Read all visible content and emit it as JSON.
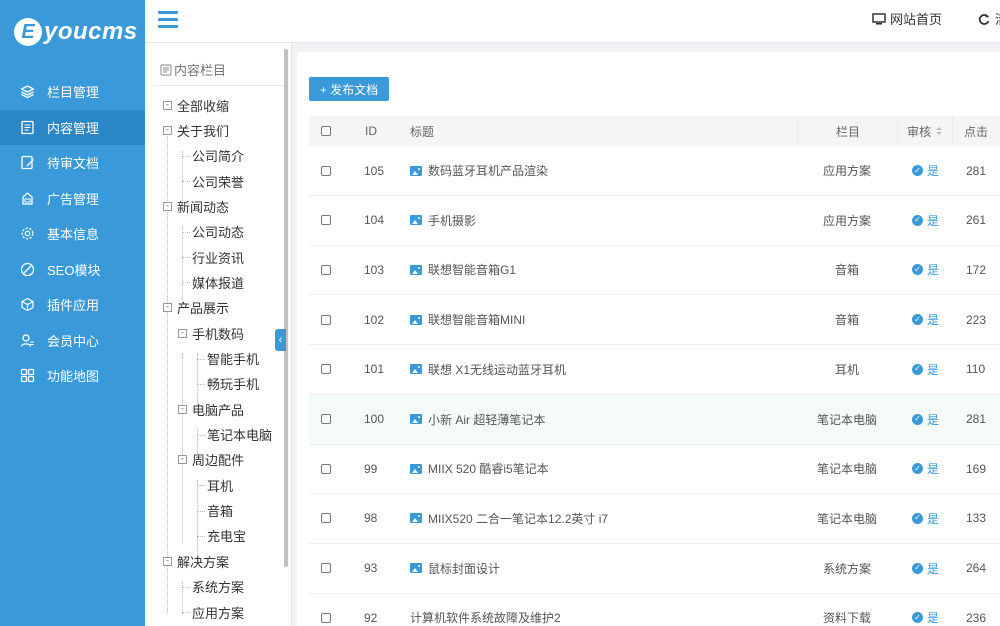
{
  "logo": {
    "letter": "E",
    "text": "youcms"
  },
  "header": {
    "home_label": "网站首页",
    "clear_label": "清"
  },
  "sidebar": {
    "items": [
      {
        "label": "栏目管理",
        "icon": "layers-icon"
      },
      {
        "label": "内容管理",
        "icon": "document-icon"
      },
      {
        "label": "待审文档",
        "icon": "edit-doc-icon"
      },
      {
        "label": "广告管理",
        "icon": "ad-icon"
      },
      {
        "label": "基本信息",
        "icon": "gear-icon"
      },
      {
        "label": "SEO模块",
        "icon": "seo-icon"
      },
      {
        "label": "插件应用",
        "icon": "plugin-icon"
      },
      {
        "label": "会员中心",
        "icon": "user-icon"
      },
      {
        "label": "功能地图",
        "icon": "grid-icon"
      }
    ],
    "active_index": 1
  },
  "tree": {
    "title": "内容栏目",
    "nodes": [
      {
        "label": "全部收缩",
        "box": "-"
      },
      {
        "label": "关于我们",
        "box": "-"
      },
      {
        "label": "公司简介"
      },
      {
        "label": "公司荣誉"
      },
      {
        "label": "新闻动态",
        "box": "-"
      },
      {
        "label": "公司动态"
      },
      {
        "label": "行业资讯"
      },
      {
        "label": "媒体报道"
      },
      {
        "label": "产品展示",
        "box": "-"
      },
      {
        "label": "手机数码",
        "box": "-"
      },
      {
        "label": "智能手机"
      },
      {
        "label": "畅玩手机"
      },
      {
        "label": "电脑产品",
        "box": "-"
      },
      {
        "label": "笔记本电脑"
      },
      {
        "label": "周边配件",
        "box": "-"
      },
      {
        "label": "耳机"
      },
      {
        "label": "音箱"
      },
      {
        "label": "充电宝"
      },
      {
        "label": "解决方案",
        "box": "-"
      },
      {
        "label": "系统方案"
      },
      {
        "label": "应用方案"
      }
    ]
  },
  "main": {
    "add_button": "+ 发布文档",
    "columns": {
      "id": "ID",
      "title": "标题",
      "category": "栏目",
      "audit": "审核",
      "clicks": "点击"
    },
    "rows": [
      {
        "id": "105",
        "title": "数码蓝牙耳机产品渲染",
        "has_image": true,
        "category": "应用方案",
        "audit": "是",
        "clicks": "281"
      },
      {
        "id": "104",
        "title": "手机摄影",
        "has_image": true,
        "category": "应用方案",
        "audit": "是",
        "clicks": "261"
      },
      {
        "id": "103",
        "title": "联想智能音箱G1",
        "has_image": true,
        "category": "音箱",
        "audit": "是",
        "clicks": "172"
      },
      {
        "id": "102",
        "title": "联想智能音箱MINI",
        "has_image": true,
        "category": "音箱",
        "audit": "是",
        "clicks": "223"
      },
      {
        "id": "101",
        "title": "联想 X1无线运动蓝牙耳机",
        "has_image": true,
        "category": "耳机",
        "audit": "是",
        "clicks": "110"
      },
      {
        "id": "100",
        "title": "小新 Air 超轻薄笔记本",
        "has_image": true,
        "category": "笔记本电脑",
        "audit": "是",
        "clicks": "281"
      },
      {
        "id": "99",
        "title": "MIIX 520 酷睿i5笔记本",
        "has_image": true,
        "category": "笔记本电脑",
        "audit": "是",
        "clicks": "169"
      },
      {
        "id": "98",
        "title": "MIIX520 二合一笔记本12.2英寸 i7",
        "has_image": true,
        "category": "笔记本电脑",
        "audit": "是",
        "clicks": "133"
      },
      {
        "id": "93",
        "title": "鼠标封面设计",
        "has_image": true,
        "category": "系统方案",
        "audit": "是",
        "clicks": "264"
      },
      {
        "id": "92",
        "title": "计算机软件系统故障及维护2",
        "has_image": false,
        "category": "资料下载",
        "audit": "是",
        "clicks": "236"
      }
    ],
    "highlighted_row": 5
  },
  "colors": {
    "accent": "#3a9ad9",
    "sidebar": "#3a9ad9",
    "sidebar_active": "#2a86c4"
  }
}
